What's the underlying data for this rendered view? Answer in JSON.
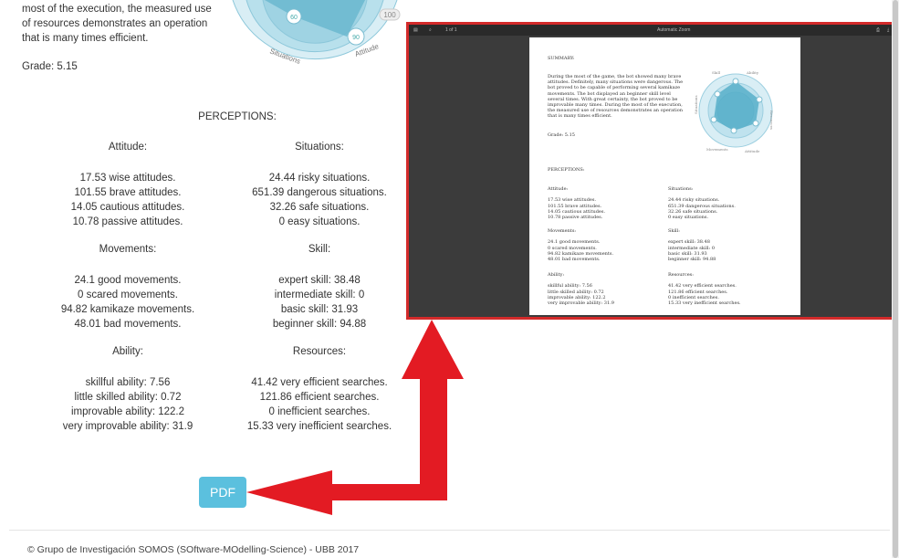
{
  "report": {
    "intro_lines": [
      "most of the execution, the measured use",
      "of resources demonstrates an operation",
      "that is many times efficient."
    ],
    "grade": "Grade: 5.15",
    "perceptions_title": "PERCEPTIONS:",
    "radar": {
      "labels": [
        "Situations",
        "Attitude"
      ],
      "values": [
        "60",
        "90",
        "100"
      ]
    }
  },
  "sections": {
    "attitude": {
      "title": "Attitude:",
      "items": [
        "17.53 wise attitudes.",
        "101.55 brave attitudes.",
        "14.05 cautious attitudes.",
        "10.78 passive attitudes."
      ]
    },
    "situations": {
      "title": "Situations:",
      "items": [
        "24.44 risky situations.",
        "651.39 dangerous situations.",
        "32.26 safe situations.",
        "0 easy situations."
      ]
    },
    "movements": {
      "title": "Movements:",
      "items": [
        "24.1 good movements.",
        "0 scared movements.",
        "94.82 kamikaze movements.",
        "48.01 bad movements."
      ]
    },
    "skill": {
      "title": "Skill:",
      "items": [
        "expert skill: 38.48",
        "intermediate skill: 0",
        "basic skill: 31.93",
        "beginner skill: 94.88"
      ]
    },
    "ability": {
      "title": "Ability:",
      "items": [
        "skillful ability: 7.56",
        "little skilled ability: 0.72",
        "improvable ability: 122.2",
        "very improvable ability: 31.9"
      ]
    },
    "resources": {
      "title": "Resources:",
      "items": [
        "41.42 very efficient searches.",
        "121.86 efficient searches.",
        "0 inefficient searches.",
        "15.33 very inefficient searches."
      ]
    }
  },
  "pdf_button": "PDF",
  "footer": "© Grupo de Investigación SOMOS (SOftware-MOdelling-Science) - UBB 2017",
  "viewer": {
    "toolbar_page": "1 of 1",
    "toolbar_zoom": "Automatic Zoom",
    "summary_title": "SUMMARY:",
    "summary_text": [
      "During the most of the game, the bot showed many brave",
      "attitudes. Definitely, many situations were dangerous. The",
      "bot proved to be capable of performing several kamikaze",
      "movements. The bot displayed an beginner skill level",
      "several times. With great certainty, the bot proved to be",
      "improvable many times. During the most of the execution,",
      "the measured use of resources demonstrates an operation",
      "that is many times efficient."
    ],
    "grade": "Grade: 5.15",
    "perceptions": "PERCEPTIONS:",
    "radar_labels": [
      "Skill",
      "Ability",
      "Resources",
      "Attitude",
      "Movements",
      "Situations"
    ]
  },
  "colors": {
    "button": "#5bc0de",
    "arrow": "#e31b23",
    "frame": "#d32a2a",
    "radar": "#4aa8c4"
  }
}
